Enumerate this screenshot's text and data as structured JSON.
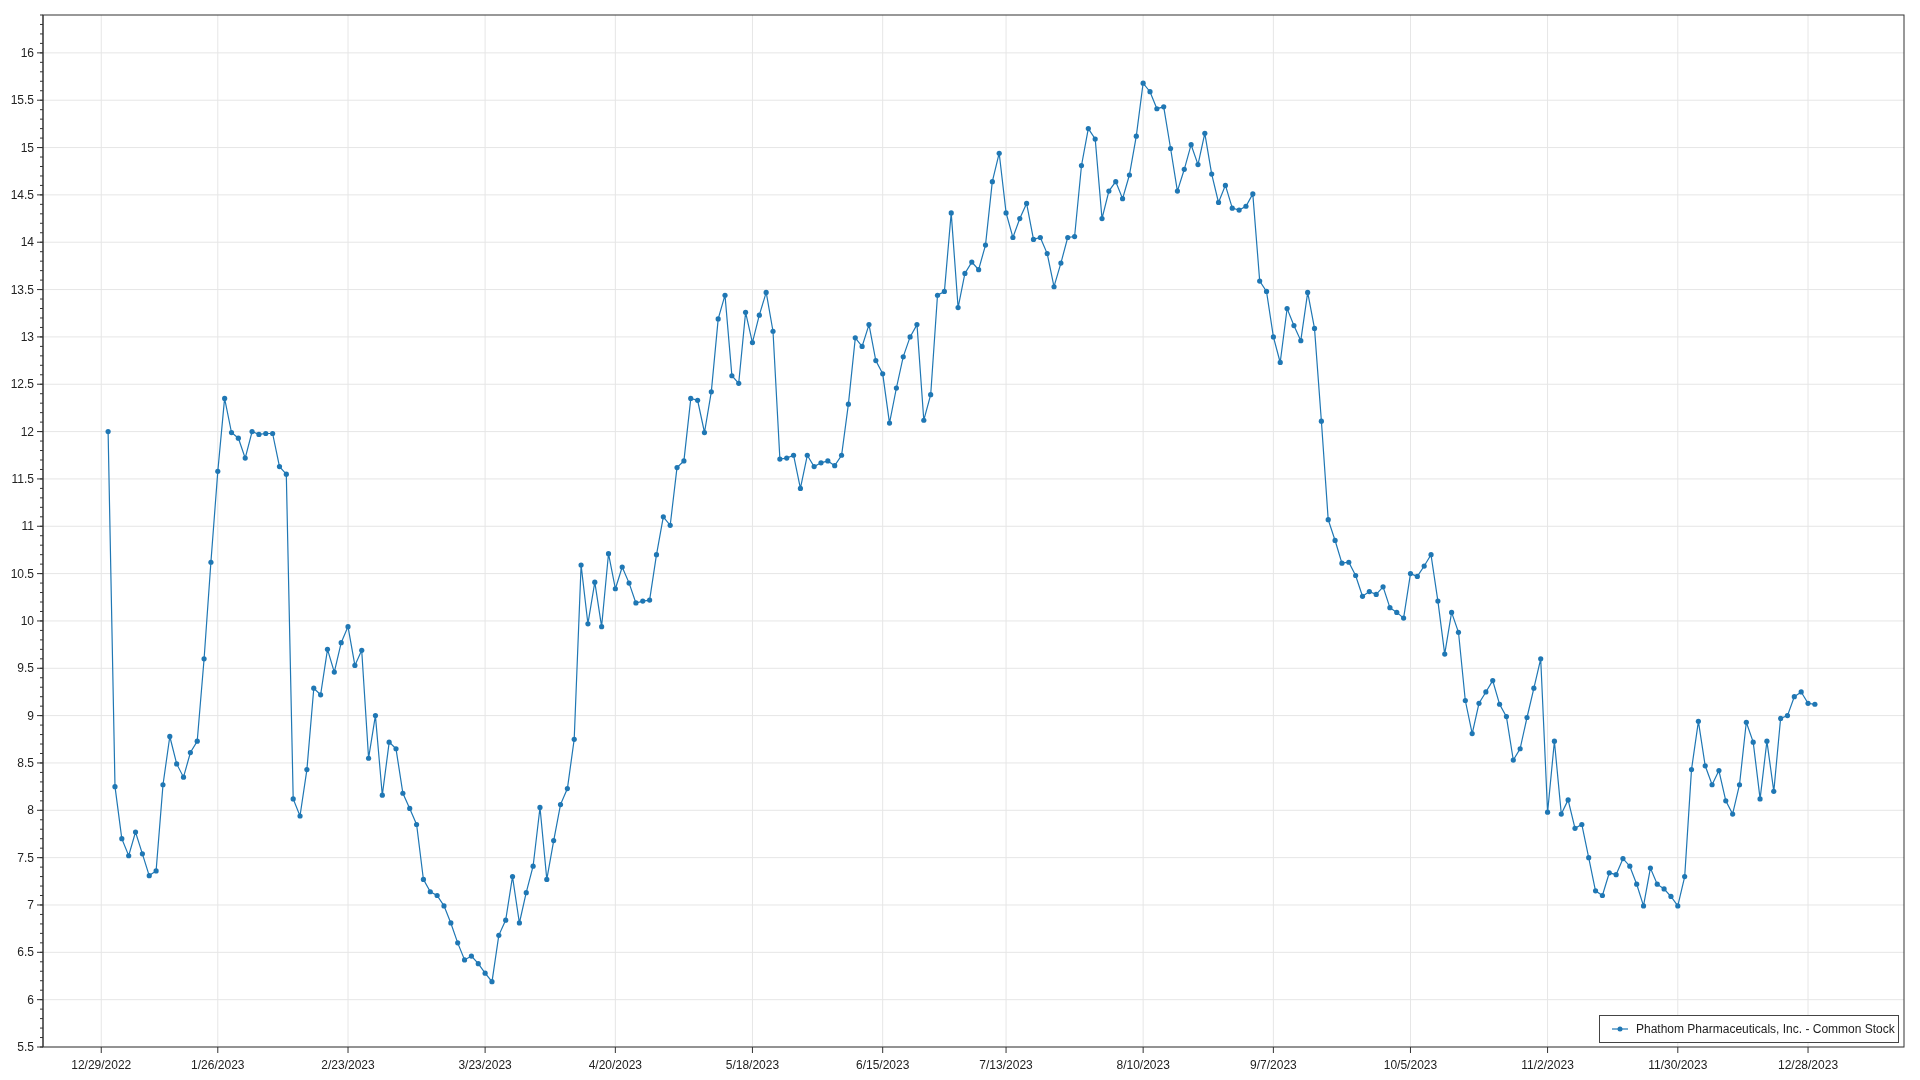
{
  "chart": {
    "chart_data": {
      "type": "line",
      "grid": true,
      "categories": [
        "12/29/2022",
        null,
        null,
        null,
        null,
        null,
        null,
        null,
        null,
        null,
        null,
        null,
        null,
        null,
        null,
        null,
        null,
        "1/26/2023",
        null,
        null,
        null,
        null,
        null,
        null,
        null,
        null,
        null,
        null,
        null,
        null,
        null,
        null,
        null,
        null,
        null,
        null,
        "2/23/2023",
        null,
        null,
        null,
        null,
        null,
        null,
        null,
        null,
        null,
        null,
        null,
        null,
        null,
        null,
        null,
        null,
        null,
        null,
        null,
        "3/23/2023",
        null,
        null,
        null,
        null,
        null,
        null,
        null,
        null,
        null,
        null,
        null,
        null,
        null,
        null,
        null,
        null,
        null,
        null,
        "4/20/2023",
        null,
        null,
        null,
        null,
        null,
        null,
        null,
        null,
        null,
        null,
        null,
        null,
        null,
        null,
        null,
        null,
        null,
        null,
        null,
        "5/18/2023",
        null,
        null,
        null,
        null,
        null,
        null,
        null,
        null,
        null,
        null,
        null,
        null,
        null,
        null,
        null,
        null,
        null,
        null,
        "6/15/2023",
        null,
        null,
        null,
        null,
        null,
        null,
        null,
        null,
        null,
        null,
        null,
        null,
        null,
        null,
        null,
        null,
        null,
        "7/13/2023",
        null,
        null,
        null,
        null,
        null,
        null,
        null,
        null,
        null,
        null,
        null,
        null,
        null,
        null,
        null,
        null,
        null,
        null,
        null,
        "8/10/2023",
        null,
        null,
        null,
        null,
        null,
        null,
        null,
        null,
        null,
        null,
        null,
        null,
        null,
        null,
        null,
        null,
        null,
        null,
        "9/7/2023",
        null,
        null,
        null,
        null,
        null,
        null,
        null,
        null,
        null,
        null,
        null,
        null,
        null,
        null,
        null,
        null,
        null,
        null,
        null,
        "10/5/2023",
        null,
        null,
        null,
        null,
        null,
        null,
        null,
        null,
        null,
        null,
        null,
        null,
        null,
        null,
        null,
        null,
        null,
        null,
        null,
        "11/2/2023",
        null,
        null,
        null,
        null,
        null,
        null,
        null,
        null,
        null,
        null,
        null,
        null,
        null,
        null,
        null,
        null,
        null,
        null,
        "11/30/2023",
        null,
        null,
        null,
        null,
        null,
        null,
        null,
        null,
        null,
        null,
        null,
        null,
        null,
        null,
        null,
        null,
        null,
        null,
        "12/28/2023",
        null
      ],
      "series": [
        {
          "name": "Phathom Pharmaceuticals, Inc. - Common Stock",
          "color": "#1f77b4",
          "values": [
            null,
            12.0,
            8.25,
            7.7,
            7.52,
            7.77,
            7.54,
            7.31,
            7.36,
            8.27,
            8.78,
            8.49,
            8.35,
            8.61,
            8.73,
            9.6,
            10.62,
            11.58,
            12.35,
            11.99,
            11.93,
            11.72,
            12.0,
            11.97,
            11.98,
            11.98,
            11.63,
            11.55,
            8.12,
            7.94,
            8.43,
            9.29,
            9.22,
            9.7,
            9.46,
            9.77,
            9.94,
            9.53,
            9.69,
            8.55,
            9.0,
            8.16,
            8.72,
            8.65,
            8.18,
            8.02,
            7.85,
            7.27,
            7.14,
            7.1,
            6.99,
            6.81,
            6.6,
            6.42,
            6.46,
            6.38,
            6.28,
            6.19,
            6.68,
            6.84,
            7.3,
            6.81,
            7.13,
            7.41,
            8.03,
            7.27,
            7.68,
            8.06,
            8.23,
            8.75,
            10.59,
            9.97,
            10.41,
            9.94,
            10.71,
            10.34,
            10.57,
            10.4,
            10.19,
            10.21,
            10.22,
            10.7,
            11.1,
            11.01,
            11.62,
            11.69,
            12.35,
            12.33,
            11.99,
            12.42,
            13.19,
            13.44,
            12.59,
            12.51,
            13.26,
            12.94,
            13.23,
            13.47,
            13.06,
            11.71,
            11.72,
            11.75,
            11.4,
            11.75,
            11.63,
            11.67,
            11.69,
            11.64,
            11.75,
            12.29,
            12.99,
            12.9,
            13.13,
            12.75,
            12.61,
            12.09,
            12.46,
            12.79,
            13.0,
            13.13,
            12.12,
            12.39,
            13.44,
            13.48,
            14.31,
            13.31,
            13.67,
            13.79,
            13.71,
            13.97,
            14.64,
            14.94,
            14.31,
            14.05,
            14.25,
            14.41,
            14.03,
            14.05,
            13.88,
            13.53,
            13.78,
            14.05,
            14.06,
            14.81,
            15.2,
            15.09,
            14.25,
            14.54,
            14.64,
            14.46,
            14.71,
            15.12,
            15.68,
            15.59,
            15.41,
            15.43,
            14.99,
            14.54,
            14.77,
            15.03,
            14.82,
            15.15,
            14.72,
            14.42,
            14.6,
            14.36,
            14.34,
            14.38,
            14.51,
            13.59,
            13.48,
            13.0,
            12.73,
            13.3,
            13.12,
            12.96,
            13.47,
            13.09,
            12.11,
            11.07,
            10.85,
            10.61,
            10.62,
            10.48,
            10.26,
            10.31,
            10.28,
            10.36,
            10.14,
            10.09,
            10.03,
            10.5,
            10.47,
            10.58,
            10.7,
            10.21,
            9.65,
            10.09,
            9.88,
            9.16,
            8.81,
            9.13,
            9.25,
            9.37,
            9.12,
            8.99,
            8.53,
            8.65,
            8.98,
            9.29,
            9.6,
            7.98,
            8.73,
            7.96,
            8.11,
            7.81,
            7.85,
            7.5,
            7.15,
            7.1,
            7.34,
            7.32,
            7.49,
            7.41,
            7.22,
            6.99,
            7.39,
            7.22,
            7.17,
            7.09,
            6.99,
            7.3,
            8.43,
            8.94,
            8.47,
            8.27,
            8.42,
            8.1,
            7.96,
            8.27,
            8.93,
            8.72,
            8.12,
            8.73,
            8.2,
            8.97,
            9.0,
            9.2,
            9.25,
            9.13,
            9.12
          ]
        }
      ],
      "ylim": [
        5.5,
        16.4
      ],
      "yticks": [
        5.5,
        6,
        6.5,
        7,
        7.5,
        8,
        8.5,
        9,
        9.5,
        10,
        10.5,
        11,
        11.5,
        12,
        12.5,
        13,
        13.5,
        14,
        14.5,
        15,
        15.5,
        16
      ]
    }
  }
}
